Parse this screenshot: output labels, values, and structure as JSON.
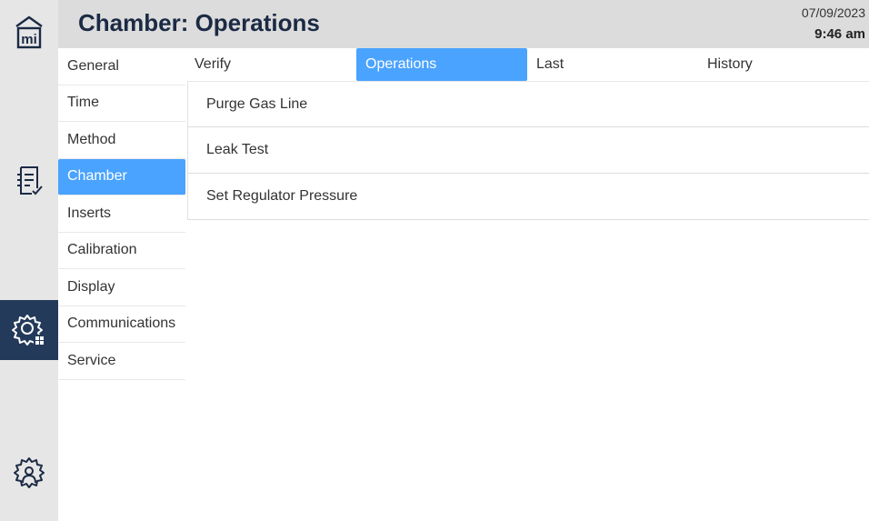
{
  "header": {
    "title": "Chamber: Operations",
    "date": "07/09/2023",
    "time": "9:46 am"
  },
  "rail": {
    "icons": [
      "home-mi-icon",
      "checklist-icon",
      "settings-grid-icon",
      "service-gear-icon"
    ],
    "active_color": "#243a5a"
  },
  "menu": {
    "items": [
      "General",
      "Time",
      "Method",
      "Chamber",
      "Inserts",
      "Calibration",
      "Display",
      "Communications",
      "Service"
    ],
    "active": "Chamber"
  },
  "tabs": {
    "items": [
      "Verify",
      "Operations",
      "Last",
      "History"
    ],
    "active": "Operations"
  },
  "operations": {
    "items": [
      "Purge Gas Line",
      "Leak Test",
      "Set Regulator Pressure"
    ]
  },
  "colors": {
    "accent": "#4aa3ff",
    "title": "#1b2a44"
  }
}
